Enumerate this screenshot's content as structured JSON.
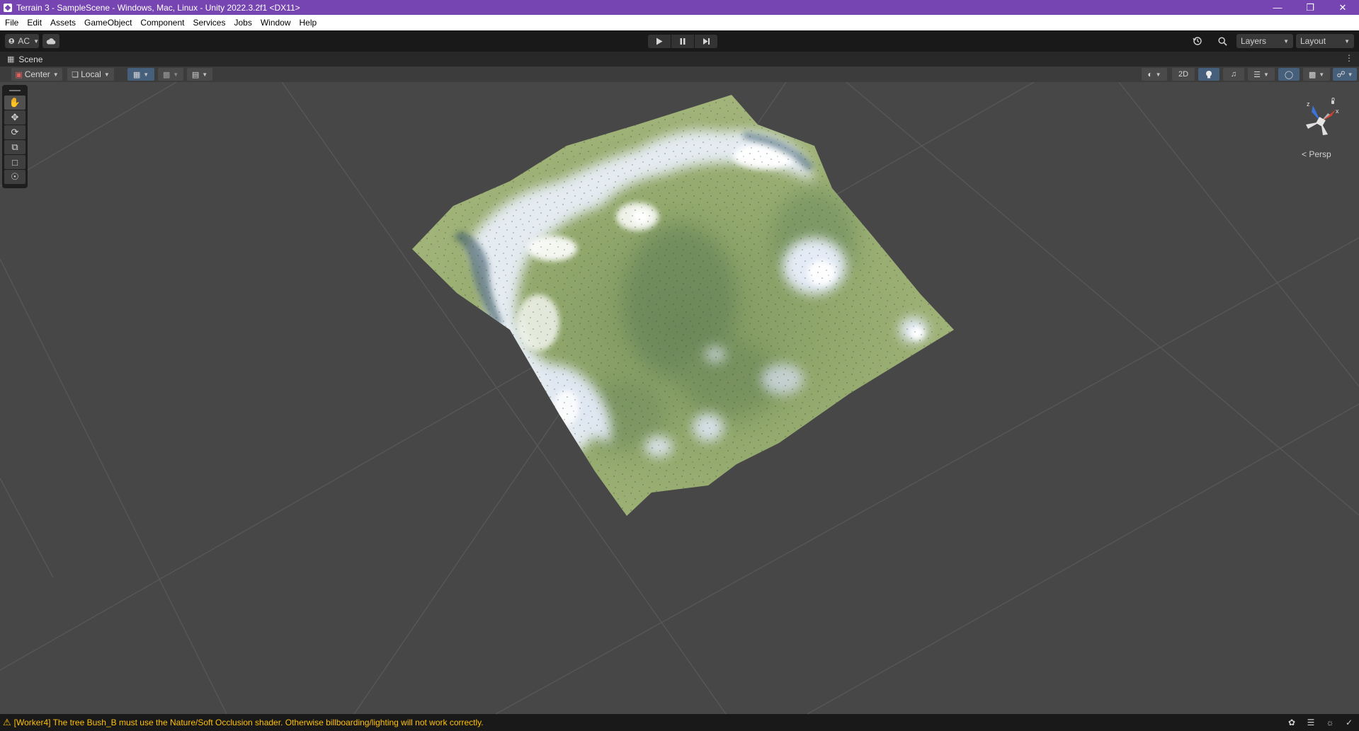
{
  "window": {
    "title": "Terrain 3 - SampleScene - Windows, Mac, Linux - Unity 2022.3.2f1 <DX11>",
    "controls": [
      "minimize-icon",
      "restore-icon",
      "close-icon"
    ]
  },
  "menu": {
    "items": [
      "File",
      "Edit",
      "Assets",
      "GameObject",
      "Component",
      "Services",
      "Jobs",
      "Window",
      "Help"
    ]
  },
  "toolbar": {
    "account_label": "AC",
    "layers_label": "Layers",
    "layout_label": "Layout",
    "icons": [
      "account-icon",
      "cloud-icon",
      "play-icon",
      "pause-icon",
      "step-icon",
      "history-icon",
      "search-icon"
    ]
  },
  "scene_tab": {
    "label": "Scene"
  },
  "scene_toolbar": {
    "pivot_label": "Center",
    "space_label": "Local",
    "mode_2d_label": "2D"
  },
  "tools": [
    "view-tool",
    "move-tool",
    "rotate-tool",
    "scale-tool",
    "rect-tool",
    "transform-tool"
  ],
  "gizmo": {
    "projection_label": "Persp",
    "axis_z_label": "z",
    "axis_x_label": "x"
  },
  "status": {
    "message": "[Worker4] The tree Bush_B must use the Nature/Soft Occlusion shader. Otherwise billboarding/lighting will not work correctly."
  },
  "colors": {
    "title_bar": "#7645b2",
    "viewport_bg": "#474747",
    "terrain_grass": "#9bac72",
    "snow": "#e8eef8",
    "warning": "#ffc107"
  }
}
